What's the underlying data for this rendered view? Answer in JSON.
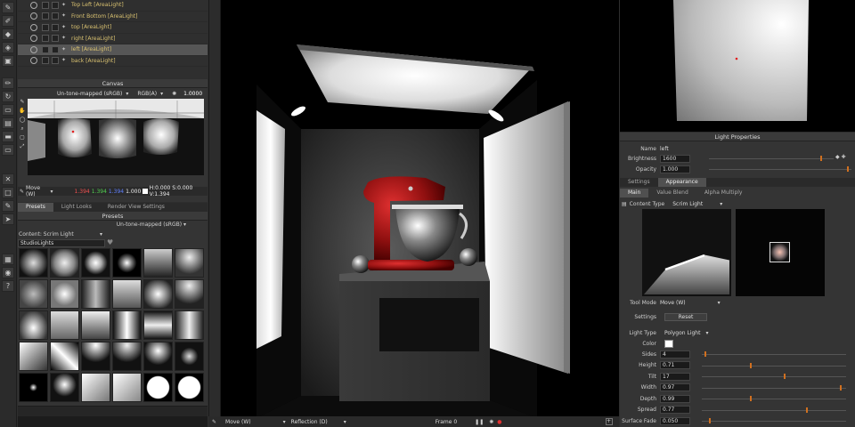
{
  "lights": {
    "items": [
      {
        "label": "Top Left [AreaLight]"
      },
      {
        "label": "Front Bottom [AreaLight]"
      },
      {
        "label": "top [AreaLight]"
      },
      {
        "label": "right [AreaLight]"
      },
      {
        "label": "left [AreaLight]",
        "selected": true
      },
      {
        "label": "back [AreaLight]"
      }
    ]
  },
  "canvas": {
    "title": "Canvas",
    "tonemap": "Un-tone-mapped (sRGB)",
    "channel": "RGB(A)",
    "exposure": "1.0000",
    "tool_mode": "Move (W)",
    "readout_r": "1.394",
    "readout_g": "1.394",
    "readout_b": "1.394",
    "readout_a": "1.000",
    "readout_hsv": "H:0.000 S:0.000 V:1.394"
  },
  "presets": {
    "tabs": [
      "Presets",
      "Light Looks",
      "Render View Settings"
    ],
    "title": "Presets",
    "tonemap": "Un-tone-mapped (sRGB)",
    "content_label": "Content: Scrim Light",
    "folder": "StudioLights"
  },
  "viewport": {
    "tool_mode": "Move (W)",
    "reflection": "Reflection (D)",
    "frame": "Frame 0"
  },
  "light_properties": {
    "title": "Light Properties",
    "name_label": "Name",
    "name_value": "left",
    "brightness_label": "Brightness",
    "brightness_value": "1600",
    "opacity_label": "Opacity",
    "opacity_value": "1.000",
    "tabs": [
      "Settings",
      "Appearance"
    ],
    "subtabs": [
      "Main",
      "Value Blend",
      "Alpha Multiply"
    ],
    "content_type_label": "Content Type",
    "content_type_value": "Scrim Light",
    "tool_mode_label": "Tool Mode",
    "tool_mode_value": "Move (W)",
    "settings_label": "Settings",
    "reset_label": "Reset",
    "light_type_label": "Light Type",
    "light_type_value": "Polygon Light",
    "color_label": "Color",
    "sides_label": "Sides",
    "sides_value": "4",
    "height_label": "Height",
    "height_value": "0.71",
    "tilt_label": "Tilt",
    "tilt_value": "17",
    "width_label": "Width",
    "width_value": "0.97",
    "depth_label": "Depth",
    "depth_value": "0.99",
    "spread_label": "Spread",
    "spread_value": "0.77",
    "surface_fade_label": "Surface Fade",
    "surface_fade_value": "0.050"
  },
  "colors": {
    "accent": "#d07020",
    "selected_row": "#565656",
    "light_label": "#d8c070"
  }
}
